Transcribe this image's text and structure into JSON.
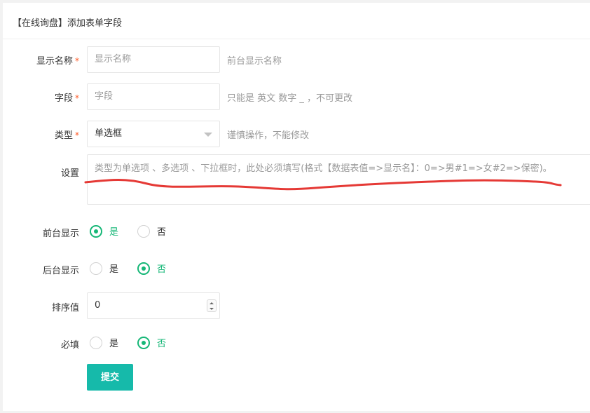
{
  "header": {
    "title": "【在线询盘】添加表单字段"
  },
  "form": {
    "display_name": {
      "label": "显示名称",
      "required_mark": "*",
      "placeholder": "显示名称",
      "hint": "前台显示名称"
    },
    "field": {
      "label": "字段",
      "required_mark": "*",
      "placeholder": "字段",
      "hint": "只能是 英文 数字 _ ，不可更改"
    },
    "type": {
      "label": "类型",
      "required_mark": "*",
      "value": "单选框",
      "hint": "谨慎操作，不能修改"
    },
    "settings": {
      "label": "设置",
      "placeholder": "类型为单选项 、多选项 、下拉框时，此处必须填写(格式【数据表值=>显示名】：0=>男#1=>女#2=>保密)。"
    },
    "front_display": {
      "label": "前台显示",
      "options": [
        "是",
        "否"
      ],
      "selected": "是"
    },
    "back_display": {
      "label": "后台显示",
      "options": [
        "是",
        "否"
      ],
      "selected": "否"
    },
    "sort": {
      "label": "排序值",
      "value": "0"
    },
    "required": {
      "label": "必填",
      "options": [
        "是",
        "否"
      ],
      "selected": "否"
    },
    "submit_label": "提交"
  },
  "colors": {
    "accent": "#16b777",
    "button": "#16baaa",
    "required": "#ff5722",
    "annotation": "#e53935"
  },
  "icons": {
    "select_caret": "caret-down-icon",
    "spinner": "stepper-arrows-icon"
  }
}
